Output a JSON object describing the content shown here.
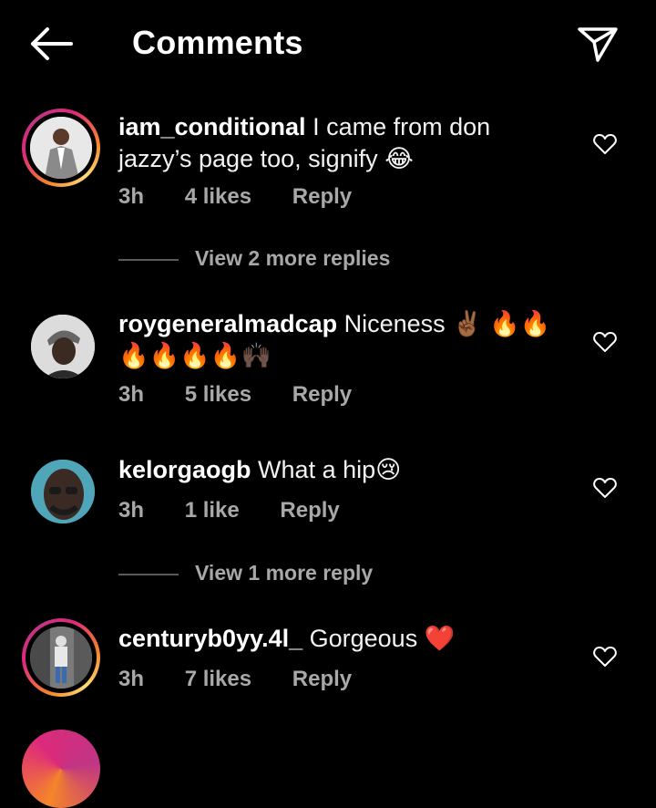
{
  "header": {
    "title": "Comments"
  },
  "comments": [
    {
      "username": "iam_conditional",
      "text": "I came from don jazzy’s page too, signify",
      "emoji": "😂",
      "time": "3h",
      "likes": "4 likes",
      "reply": "Reply",
      "view_more": "View 2 more replies"
    },
    {
      "username": "roygeneralmadcap",
      "text": "Niceness",
      "emoji_line": "✌🏾 🔥🔥",
      "emoji_line2": "🔥🔥🔥🔥🙌🏿",
      "time": "3h",
      "likes": "5 likes",
      "reply": "Reply"
    },
    {
      "username": "kelorgaogb",
      "text": "What a hip",
      "emoji": "😢",
      "time": "3h",
      "likes": "1 like",
      "reply": "Reply",
      "view_more": "View 1 more reply"
    },
    {
      "username": "centuryb0yy.4l_",
      "text": "Gorgeous",
      "emoji": "❤️",
      "time": "3h",
      "likes": "7 likes",
      "reply": "Reply"
    }
  ],
  "colors": {
    "background": "#000000",
    "text": "#ffffff",
    "muted": "#a8a8a8",
    "story_ring": "#dd2a7b"
  },
  "icons": {
    "back": "arrow-left-icon",
    "send": "send-icon",
    "like": "heart-outline-icon"
  }
}
